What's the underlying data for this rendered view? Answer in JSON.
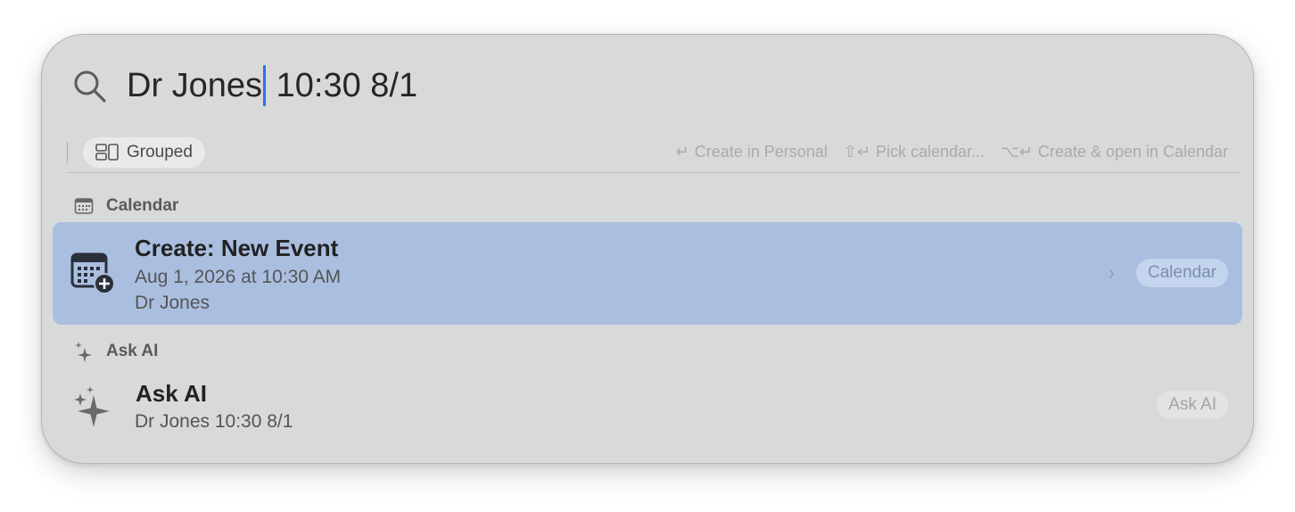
{
  "search": {
    "query_before_caret": "Dr Jones",
    "query_after_caret": " 10:30 8/1"
  },
  "filter": {
    "grouped_label": "Grouped"
  },
  "hints": [
    {
      "keys": "↵",
      "label": "Create in Personal"
    },
    {
      "keys": "⇧↵",
      "label": "Pick calendar..."
    },
    {
      "keys": "⌥↵",
      "label": "Create & open in Calendar"
    }
  ],
  "sections": {
    "calendar": {
      "header": "Calendar",
      "item": {
        "title": "Create: New Event",
        "subtitle_line1": "Aug 1, 2026 at 10:30 AM",
        "subtitle_line2": "Dr Jones",
        "badge": "Calendar",
        "icon": "calendar-add-icon"
      }
    },
    "ask_ai": {
      "header": "Ask AI",
      "item": {
        "title": "Ask AI",
        "subtitle": "Dr Jones 10:30 8/1",
        "badge": "Ask AI",
        "icon": "sparkles-icon"
      }
    }
  },
  "colors": {
    "panel_bg": "#d8d9d9",
    "selected_row": "#aabfe0",
    "caret": "#2f6ff0"
  }
}
